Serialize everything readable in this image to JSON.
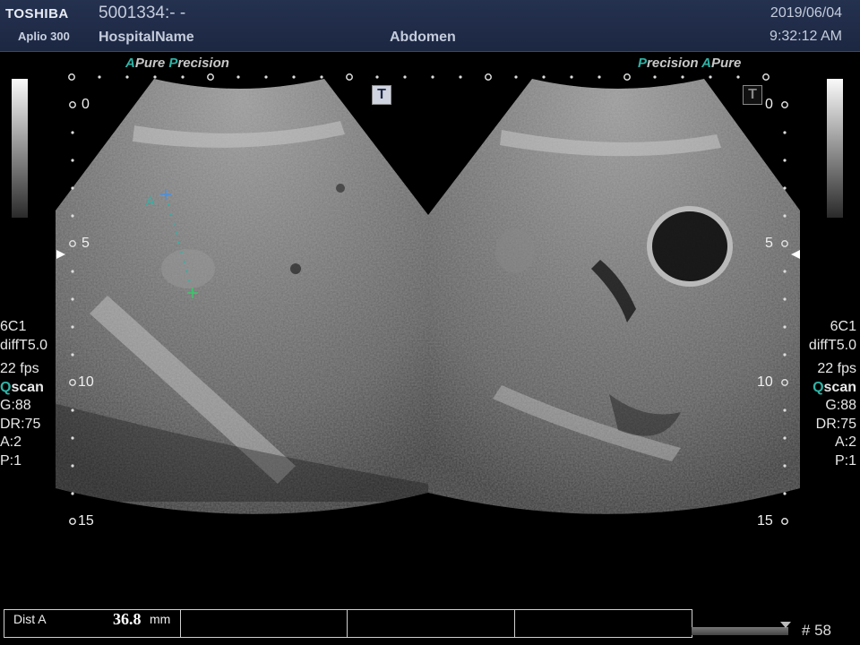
{
  "header": {
    "brand": "TOSHIBA",
    "model": "Aplio 300",
    "patient_id": "5001334:- -",
    "hospital": "HospitalName",
    "exam": "Abdomen",
    "date": "2019/06/04",
    "time": "9:32:12 AM"
  },
  "left_panel": {
    "mode_a": "A",
    "mode_pure": "Pure",
    "mode_p": "P",
    "mode_recision": "recision",
    "depth_marks": [
      "0",
      "5",
      "10",
      "15"
    ],
    "t_icon": "T",
    "probe": "6C1",
    "harmonic": "diffT5.0",
    "frame_rate": "22 fps",
    "qscan_q": "Q",
    "qscan_rest": "scan",
    "gain": "G:88",
    "dynamic_range": "DR:75",
    "a_setting": "A:2",
    "p_setting": "P:1"
  },
  "right_panel": {
    "mode_p": "P",
    "mode_recision": "recision",
    "mode_a": "A",
    "mode_pure": "Pure",
    "depth_marks": [
      "0",
      "5",
      "10",
      "15"
    ],
    "t_icon": "T",
    "probe": "6C1",
    "harmonic": "diffT5.0",
    "frame_rate": "22 fps",
    "qscan_q": "Q",
    "qscan_rest": "scan",
    "gain": "G:88",
    "dynamic_range": "DR:75",
    "a_setting": "A:2",
    "p_setting": "P:1"
  },
  "caliper": {
    "label": "A",
    "color_start": "#4a8fe0",
    "color_end": "#3ec76a",
    "color_dots": "#2fb3a6"
  },
  "measurement": {
    "name": "Dist A",
    "value": "36.8",
    "unit": "mm"
  },
  "frame": {
    "number": "# 58"
  },
  "colors": {
    "header_bg": "#1c2742",
    "accent_teal": "#2fb3a6"
  }
}
